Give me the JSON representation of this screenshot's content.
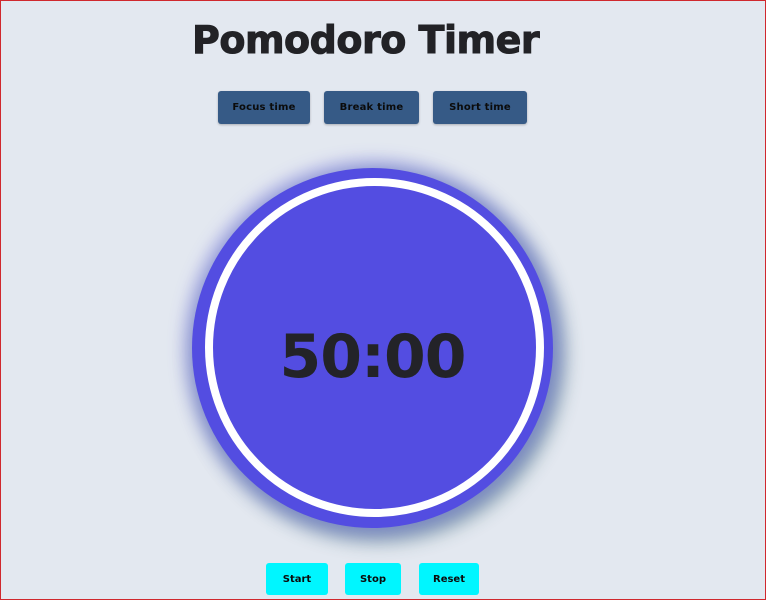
{
  "app": {
    "title": "Pomodoro Timer"
  },
  "modes": {
    "focus_label": "Focus time",
    "break_label": "Break time",
    "short_label": "Short time"
  },
  "timer": {
    "display": "50:00"
  },
  "controls": {
    "start_label": "Start",
    "stop_label": "Stop",
    "reset_label": "Reset"
  },
  "colors": {
    "background": "#e3e8f0",
    "mode_button": "#365a86",
    "dial": "#534de1",
    "dial_ring": "#ffffff",
    "control_button": "#00f6ff",
    "text": "#222226"
  }
}
